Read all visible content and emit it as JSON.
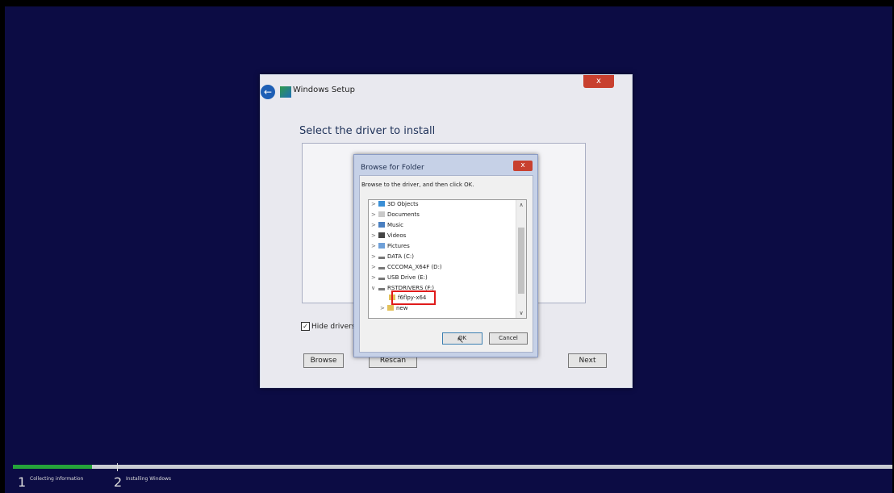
{
  "setup_window": {
    "title": "Windows Setup",
    "close_label": "x",
    "heading": "Select the driver to install",
    "hide_drivers_label": "Hide drivers th",
    "browse_label": "Browse",
    "rescan_label": "Rescan",
    "next_label": "Next"
  },
  "browse_dialog": {
    "title": "Browse for Folder",
    "close_label": "x",
    "instruction": "Browse to the driver, and then click OK.",
    "tree_items": [
      {
        "label": "3D Objects",
        "icon": "3d-objects-icon"
      },
      {
        "label": "Documents",
        "icon": "documents-icon"
      },
      {
        "label": "Music",
        "icon": "music-icon"
      },
      {
        "label": "Videos",
        "icon": "videos-icon"
      },
      {
        "label": "Pictures",
        "icon": "pictures-icon"
      },
      {
        "label": "DATA (C:)",
        "icon": "drive-icon"
      },
      {
        "label": "CCCOMA_X64F (D:)",
        "icon": "drive-icon"
      },
      {
        "label": "USB Drive (E:)",
        "icon": "usb-drive-icon"
      },
      {
        "label": "RSTDRIVERS (F:)",
        "icon": "drive-icon"
      },
      {
        "label": "f6flpy-x64",
        "icon": "folder-icon",
        "selected": true
      },
      {
        "label": "new",
        "icon": "folder-icon"
      }
    ],
    "ok_label": "OK",
    "cancel_label": "Cancel"
  },
  "progress": {
    "fraction": 0.09,
    "steps": [
      {
        "number": "1",
        "label": "Collecting information"
      },
      {
        "number": "2",
        "label": "Installing Windows"
      }
    ]
  },
  "colors": {
    "background": "#0c0c44",
    "progress_fill": "#25a43a",
    "highlight_box": "#e01b1b"
  }
}
